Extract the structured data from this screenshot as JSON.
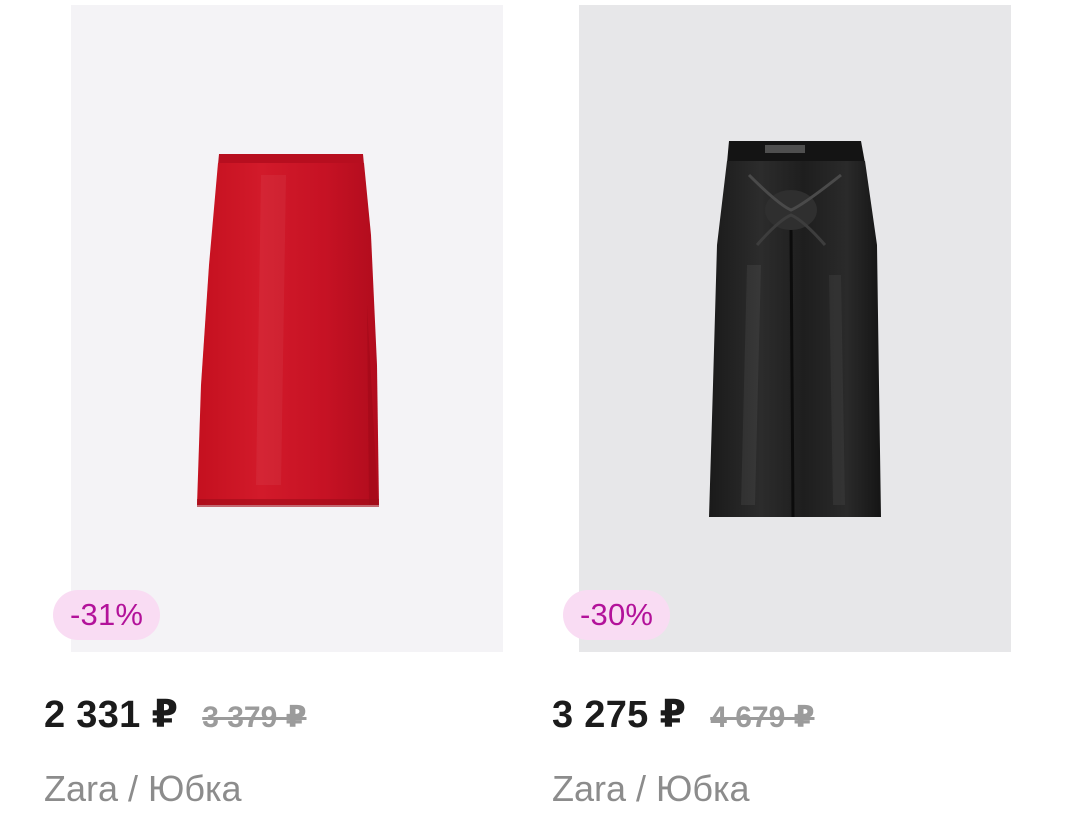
{
  "products": [
    {
      "discount": "-31%",
      "price": "2 331 ₽",
      "old_price": "3 379 ₽",
      "title": "Zara / Юбка",
      "image_icon": "red-satin-midi-skirt"
    },
    {
      "discount": "-30%",
      "price": "3 275 ₽",
      "old_price": "4 679 ₽",
      "title": "Zara / Юбка",
      "image_icon": "black-faux-leather-knot-skirt"
    }
  ],
  "colors": {
    "badge_bg": "#f9dcf3",
    "badge_text": "#b3129a",
    "price": "#1b1b1b",
    "old_price": "#9b9b9b",
    "title": "#8c8c8c"
  }
}
